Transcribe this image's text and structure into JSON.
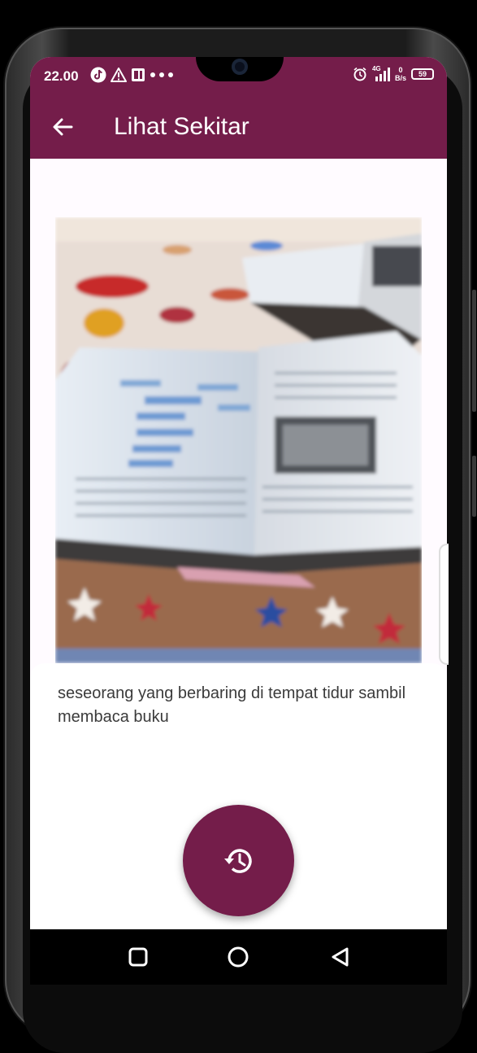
{
  "status_bar": {
    "time": "22.00",
    "net_speed_value": "0",
    "net_speed_unit": "B/s",
    "signal_label": "4G",
    "battery": "59"
  },
  "app_bar": {
    "title": "Lihat Sekitar"
  },
  "result": {
    "caption": "seseorang yang berbaring di tempat tidur sambil membaca buku"
  },
  "colors": {
    "primary": "#741d4a",
    "background": "#fffbff",
    "card": "#ffffff"
  },
  "icons": {
    "back": "arrow-left-icon",
    "fab": "history-icon",
    "nav_recent": "square-icon",
    "nav_home": "circle-icon",
    "nav_back": "triangle-back-icon"
  }
}
